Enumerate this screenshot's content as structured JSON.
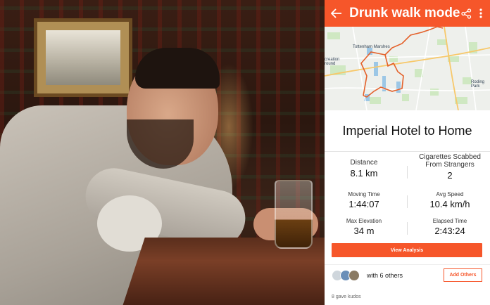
{
  "header": {
    "title": "Drunk walk mode",
    "back_icon": "arrow-left-icon",
    "share_icon": "share-icon",
    "more_icon": "more-vertical-icon",
    "accent_color": "#f6562a"
  },
  "map": {
    "labels": {
      "tottenham": "Tottenham Marshes",
      "recreation": "creation\nround",
      "roding": "Roding\nPark"
    },
    "route_color": "#e4612b"
  },
  "route": {
    "title": "Imperial Hotel to Home"
  },
  "stats": [
    {
      "label": "Distance",
      "value": "8.1 km"
    },
    {
      "label": "Cigarettes Scabbed\nFrom Strangers",
      "value": "2"
    },
    {
      "label": "Moving Time",
      "value": "1:44:07"
    },
    {
      "label": "Avg Speed",
      "value": "10.4 km/h"
    },
    {
      "label": "Max Elevation",
      "value": "34 m"
    },
    {
      "label": "Elapsed Time",
      "value": "2:43:24"
    }
  ],
  "actions": {
    "view_analysis": "View Analysis",
    "add_others": "Add Others"
  },
  "social": {
    "with_others": "with 6 others",
    "kudos": "8 gave kudos",
    "avatar_colors": [
      "#cfd6dc",
      "#6b8fb8",
      "#8a7a63"
    ]
  }
}
